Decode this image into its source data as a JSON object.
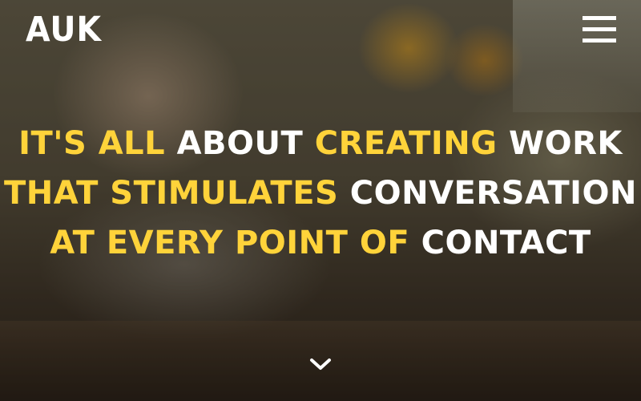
{
  "header": {
    "logo_text": "AUK",
    "menu_icon": "hamburger-menu-icon"
  },
  "hero": {
    "headline_lines": [
      [
        {
          "text": "IT'S ALL",
          "style": "accent"
        },
        {
          "text": "ABOUT",
          "style": "plain"
        },
        {
          "text": "CREATING",
          "style": "accent"
        },
        {
          "text": "WORK",
          "style": "plain"
        }
      ],
      [
        {
          "text": "THAT STIMULATES",
          "style": "accent"
        },
        {
          "text": "CONVERSATION",
          "style": "plain"
        }
      ],
      [
        {
          "text": "AT EVERY POINT OF",
          "style": "accent"
        },
        {
          "text": "CONTACT",
          "style": "plain"
        }
      ]
    ],
    "scroll_icon": "chevron-down-icon"
  },
  "colors": {
    "accent": "#ffd33a",
    "plain": "#ffffff"
  }
}
